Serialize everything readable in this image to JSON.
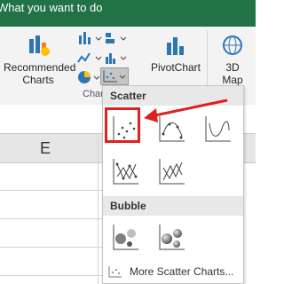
{
  "tell_me": "What you want to do",
  "ribbon": {
    "recommended_charts_line1": "Recommended",
    "recommended_charts_line2": "Charts",
    "pivotchart_label": "PivotChart",
    "map_line1": "3D",
    "map_line2": "Map",
    "group_label": "Charts"
  },
  "sheet": {
    "column_e": "E"
  },
  "dropdown": {
    "scatter_header": "Scatter",
    "bubble_header": "Bubble",
    "more_label": "More Scatter Charts..."
  },
  "colors": {
    "excel_green": "#217346",
    "highlight": "#e0201c",
    "chart_blue": "#2e75b6"
  }
}
